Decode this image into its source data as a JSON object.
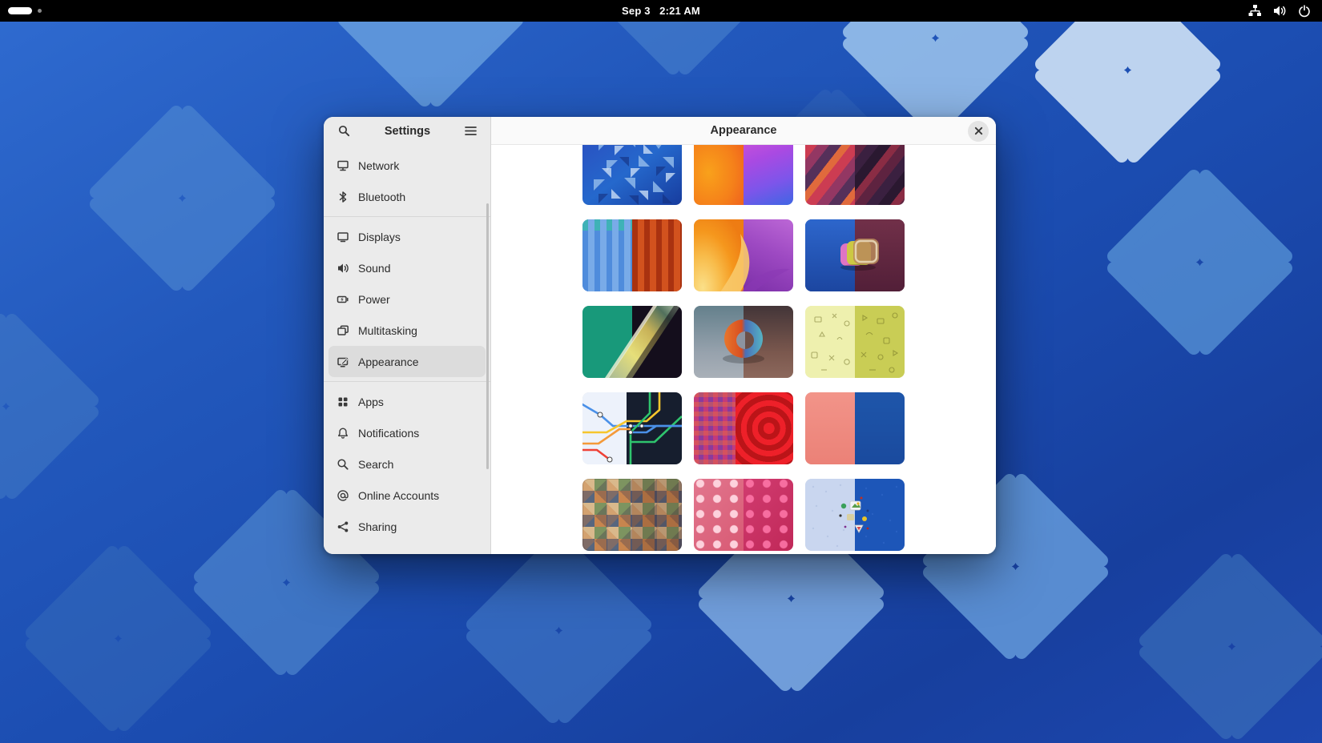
{
  "topbar": {
    "date": "Sep 3",
    "time": "2:21 AM",
    "right_icons": [
      "network-icon",
      "volume-icon",
      "power-icon"
    ]
  },
  "window": {
    "sidebar": {
      "title": "Settings",
      "items": [
        {
          "label": "Network",
          "icon": "network-display-icon"
        },
        {
          "label": "Bluetooth",
          "icon": "bluetooth-icon"
        },
        {
          "label": "Displays",
          "icon": "display-icon"
        },
        {
          "label": "Sound",
          "icon": "speaker-icon"
        },
        {
          "label": "Power",
          "icon": "power-battery-icon"
        },
        {
          "label": "Multitasking",
          "icon": "multitasking-windows-icon"
        },
        {
          "label": "Appearance",
          "icon": "appearance-display-pencil-icon",
          "selected": true
        },
        {
          "label": "Apps",
          "icon": "apps-grid-icon"
        },
        {
          "label": "Notifications",
          "icon": "bell-icon"
        },
        {
          "label": "Search",
          "icon": "magnifier-icon"
        },
        {
          "label": "Online Accounts",
          "icon": "at-symbol-icon"
        },
        {
          "label": "Sharing",
          "icon": "share-nodes-icon"
        }
      ]
    },
    "header": {
      "title": "Appearance"
    },
    "wallpapers": [
      {
        "name": "blue-triangle-mosaic"
      },
      {
        "name": "orange-magenta-gradient-split"
      },
      {
        "name": "dark-wavy-folds-split"
      },
      {
        "name": "blue-orange-drips-split"
      },
      {
        "name": "orange-purple-petal-split"
      },
      {
        "name": "glass-cubes-blue-maroon-split"
      },
      {
        "name": "teal-prism-ribbon-split"
      },
      {
        "name": "torus-ring-split"
      },
      {
        "name": "yellow-doodle-icons-split"
      },
      {
        "name": "transit-map-light-dark-split"
      },
      {
        "name": "magenta-red-labyrinth-split"
      },
      {
        "name": "coral-blue-plain-split"
      },
      {
        "name": "geometric-tile-mosaic"
      },
      {
        "name": "pink-pills-split"
      },
      {
        "name": "sticker-dots-blue-split"
      }
    ]
  },
  "colors": {
    "accent_blue": "#1b4cb0",
    "topbar_bg": "#000000",
    "sidebar_bg": "#ebebeb",
    "selected_row": "#dcdcdc",
    "content_bg": "#ffffff"
  }
}
